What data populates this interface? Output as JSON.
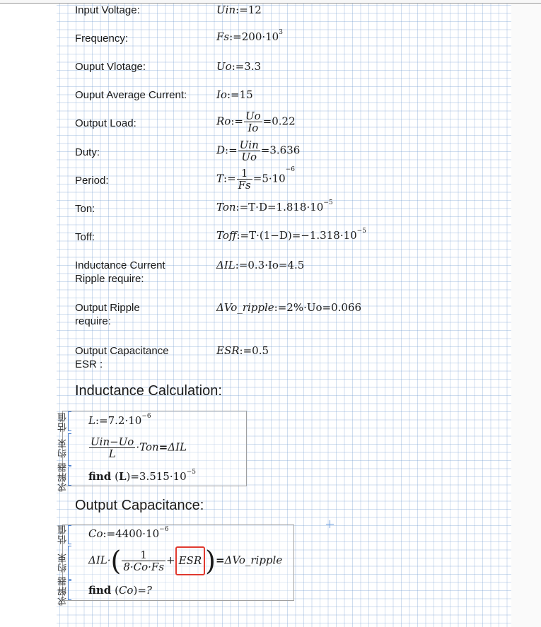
{
  "params": [
    {
      "label": "Input Voltage:",
      "var": "Uin",
      "expr": ":=12"
    },
    {
      "label": "Frequency:",
      "var": "Fs",
      "expr": ":=200·10",
      "exp": "3"
    },
    {
      "label": "Ouput Vlotage:",
      "var": "Uo",
      "expr": ":=3.3"
    },
    {
      "label": "Ouput Average Current:",
      "var": "Io",
      "expr": ":=15"
    },
    {
      "label": "Output Load:",
      "var": "Ro",
      "num": "Uo",
      "den": "Io",
      "result": "=0.22"
    },
    {
      "label": "Duty:",
      "var": "D",
      "num": "Uin",
      "den": "Uo",
      "result": "=3.636"
    },
    {
      "label": "Period:",
      "var": "T",
      "num": "1",
      "den": "Fs",
      "result": "=5·10",
      "exp": "−6"
    },
    {
      "label": "Ton:",
      "var": "Ton",
      "expr": ":=T·D=1.818·10",
      "exp": "−5"
    },
    {
      "label": "Toff:",
      "var": "Toff",
      "expr": ":=T·(1−D)=−1.318·10",
      "exp": "−5"
    },
    {
      "label": "Inductance Current",
      "label2": "Ripple require:",
      "var": "ΔIL",
      "expr": ":=0.3·Io=4.5"
    },
    {
      "label": "Output Ripple",
      "label2": "require:",
      "var": "ΔVo_ripple",
      "expr": ":=2%·Uo=0.066"
    },
    {
      "label": "Output Capacitance",
      "label2": "ESR :",
      "var": "ESR",
      "expr": ":=0.5"
    }
  ],
  "headings": {
    "inductance": "Inductance Calculation:",
    "capacitance": "Output Capacitance:"
  },
  "solve_labels": {
    "guess": "估值",
    "constraint": "约束",
    "solver": "求解器"
  },
  "inductance_block": {
    "guess_var": "L",
    "guess_expr": ":=7.2·10",
    "guess_exp": "−6",
    "num": "Uin−Uo",
    "den": "L",
    "rest": "·Ton",
    "eq": "=",
    "rhs": "ΔIL",
    "find": "find",
    "find_arg": "L",
    "find_result": "=3.515·10",
    "find_exp": "−5"
  },
  "capacitance_block": {
    "guess_var": "Co",
    "guess_expr": ":=4400·10",
    "guess_exp": "−6",
    "lhs": "ΔIL·",
    "num": "1",
    "den": "8·Co·Fs",
    "plus": "+",
    "esr": "ESR",
    "eq": "=",
    "rhs": "ΔVo_ripple",
    "find": "find",
    "find_arg": "Co",
    "find_result": "=?"
  }
}
